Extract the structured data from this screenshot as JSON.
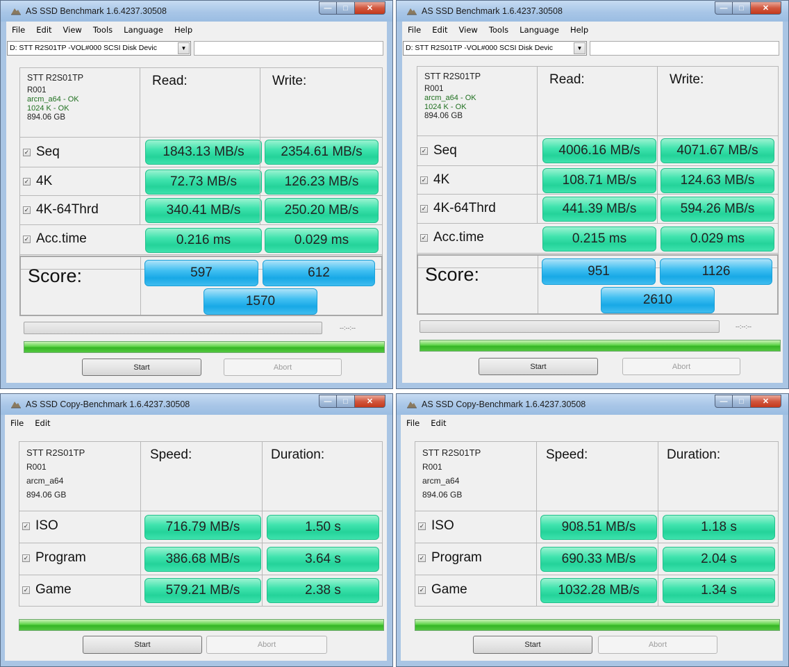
{
  "windows": [
    {
      "title": "AS SSD Benchmark 1.6.4237.30508",
      "menu": [
        "File",
        "Edit",
        "View",
        "Tools",
        "Language",
        "Help"
      ],
      "drive_select": "D: STT R2S01TP -VOL#000 SCSI Disk Devic",
      "drive": {
        "name": "STT R2S01TP",
        "fw": "R001",
        "driver": "arcm_a64 - OK",
        "align": "1024 K - OK",
        "size": "894.06 GB"
      },
      "col_read": "Read:",
      "col_write": "Write:",
      "rows": [
        {
          "label": "Seq",
          "read": "1843.13 MB/s",
          "write": "2354.61 MB/s"
        },
        {
          "label": "4K",
          "read": "72.73 MB/s",
          "write": "126.23 MB/s"
        },
        {
          "label": "4K-64Thrd",
          "read": "340.41 MB/s",
          "write": "250.20 MB/s"
        },
        {
          "label": "Acc.time",
          "read": "0.216 ms",
          "write": "0.029 ms"
        }
      ],
      "score_label": "Score:",
      "score_read": "597",
      "score_write": "612",
      "score_total": "1570",
      "time": "--:--:--",
      "start": "Start",
      "abort": "Abort"
    },
    {
      "title": "AS SSD Benchmark 1.6.4237.30508",
      "menu": [
        "File",
        "Edit",
        "View",
        "Tools",
        "Language",
        "Help"
      ],
      "drive_select": "D: STT R2S01TP -VOL#000 SCSI Disk Devic",
      "drive": {
        "name": "STT R2S01TP",
        "fw": "R001",
        "driver": "arcm_a64 - OK",
        "align": "1024 K - OK",
        "size": "894.06 GB"
      },
      "col_read": "Read:",
      "col_write": "Write:",
      "rows": [
        {
          "label": "Seq",
          "read": "4006.16 MB/s",
          "write": "4071.67 MB/s"
        },
        {
          "label": "4K",
          "read": "108.71 MB/s",
          "write": "124.63 MB/s"
        },
        {
          "label": "4K-64Thrd",
          "read": "441.39 MB/s",
          "write": "594.26 MB/s"
        },
        {
          "label": "Acc.time",
          "read": "0.215 ms",
          "write": "0.029 ms"
        }
      ],
      "score_label": "Score:",
      "score_read": "951",
      "score_write": "1126",
      "score_total": "2610",
      "time": "--:--:--",
      "start": "Start",
      "abort": "Abort"
    },
    {
      "title": "AS SSD Copy-Benchmark 1.6.4237.30508",
      "menu": [
        "File",
        "Edit"
      ],
      "drive": {
        "name": "STT R2S01TP",
        "fw": "R001",
        "driver": "arcm_a64",
        "size": "894.06 GB"
      },
      "col_speed": "Speed:",
      "col_duration": "Duration:",
      "rows": [
        {
          "label": "ISO",
          "speed": "716.79 MB/s",
          "duration": "1.50 s"
        },
        {
          "label": "Program",
          "speed": "386.68 MB/s",
          "duration": "3.64 s"
        },
        {
          "label": "Game",
          "speed": "579.21 MB/s",
          "duration": "2.38 s"
        }
      ],
      "start": "Start",
      "abort": "Abort"
    },
    {
      "title": "AS SSD Copy-Benchmark 1.6.4237.30508",
      "menu": [
        "File",
        "Edit"
      ],
      "drive": {
        "name": "STT R2S01TP",
        "fw": "R001",
        "driver": "arcm_a64",
        "size": "894.06 GB"
      },
      "col_speed": "Speed:",
      "col_duration": "Duration:",
      "rows": [
        {
          "label": "ISO",
          "speed": "908.51 MB/s",
          "duration": "1.18 s"
        },
        {
          "label": "Program",
          "speed": "690.33 MB/s",
          "duration": "2.04 s"
        },
        {
          "label": "Game",
          "speed": "1032.28 MB/s",
          "duration": "1.34 s"
        }
      ],
      "start": "Start",
      "abort": "Abort"
    }
  ],
  "checkbox_mark": "✓",
  "progress_complete": 1.0
}
